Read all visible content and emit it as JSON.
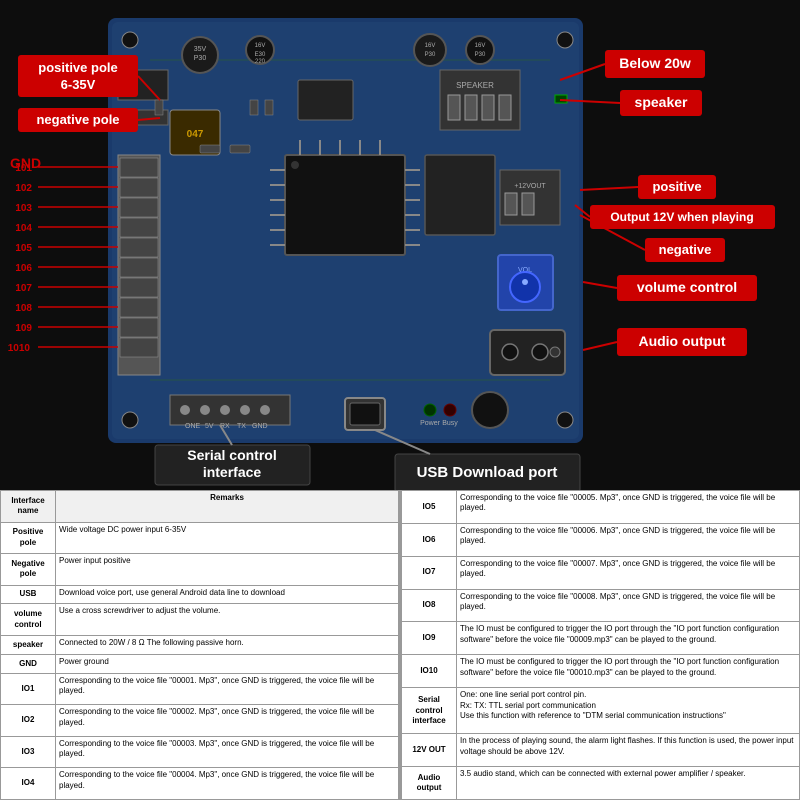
{
  "board": {
    "labels": {
      "positive_pole": "positive pole\n6-35V",
      "negative_pole": "negative pole",
      "gnd": "GND",
      "below20w": "Below 20w",
      "speaker": "speaker",
      "positive": "positive",
      "output12v": "Output 12V when playing",
      "negative": "negative",
      "volume_control": "volume control",
      "audio_output": "Audio output",
      "serial_control": "Serial control\ninterface",
      "usb_download": "USB Download port"
    },
    "io_pins": [
      "101",
      "102",
      "103",
      "104",
      "105",
      "106",
      "107",
      "108",
      "109",
      "1010"
    ]
  },
  "table": {
    "header": [
      "Interface name",
      "Remarks"
    ],
    "rows_left": [
      {
        "name": "Positive pole",
        "remarks": "Wide voltage DC power input 6-35V"
      },
      {
        "name": "Negative pole",
        "remarks": "Power input positive"
      },
      {
        "name": "USB",
        "remarks": "Download voice port, use general Android data line to download"
      },
      {
        "name": "volume control",
        "remarks": "Use a cross screwdriver to adjust the volume."
      },
      {
        "name": "speaker",
        "remarks": "Connected to 20W / 8 Ω  The following passive horn."
      },
      {
        "name": "GND",
        "remarks": "Power ground"
      },
      {
        "name": "IO1",
        "remarks": "Corresponding to the voice file \"00001. Mp3\", once GND is triggered, the voice file will be played."
      },
      {
        "name": "IO2",
        "remarks": "Corresponding to the voice file \"00002. Mp3\", once GND is triggered, the voice file will be played."
      },
      {
        "name": "IO3",
        "remarks": "Corresponding to the voice file \"00003. Mp3\", once GND is triggered, the voice file will be played."
      },
      {
        "name": "IO4",
        "remarks": "Corresponding to the voice file \"00004. Mp3\", once GND is triggered, the voice file will be played."
      }
    ],
    "rows_right": [
      {
        "name": "IO5",
        "remarks": "Corresponding to the voice file \"00005. Mp3\", once GND is triggered, the voice file will be played."
      },
      {
        "name": "IO6",
        "remarks": "Corresponding to the voice file \"00006. Mp3\", once GND is triggered, the voice file will be played."
      },
      {
        "name": "IO7",
        "remarks": "Corresponding to the voice file \"00007. Mp3\", once GND is triggered, the voice file will be played."
      },
      {
        "name": "IO8",
        "remarks": "Corresponding to the voice file \"00008. Mp3\", once GND is triggered, the voice file will be played."
      },
      {
        "name": "IO9",
        "remarks": "The IO must be configured to trigger the IO port through the \"IO port function configuration software\" before the voice file \"00009.mp3\" can be played to the ground."
      },
      {
        "name": "IO10",
        "remarks": "The IO must be configured to trigger the IO port through the \"IO port function configuration software\" before the voice file \"00010.mp3\" can be played to the ground."
      },
      {
        "name": "Serial control interface",
        "remarks": "One: one line serial port control pin.\nRx: TX: TTL serial port communication\nUse this function with reference to \"DTM serial communication instructions\""
      },
      {
        "name": "12V OUT",
        "remarks": "In the process of playing sound, the alarm light flashes. If this function is used, the power input voltage should be above 12V."
      },
      {
        "name": "Audio output",
        "remarks": "3.5 audio stand, which can be connected with external power amplifier / speaker."
      }
    ]
  }
}
